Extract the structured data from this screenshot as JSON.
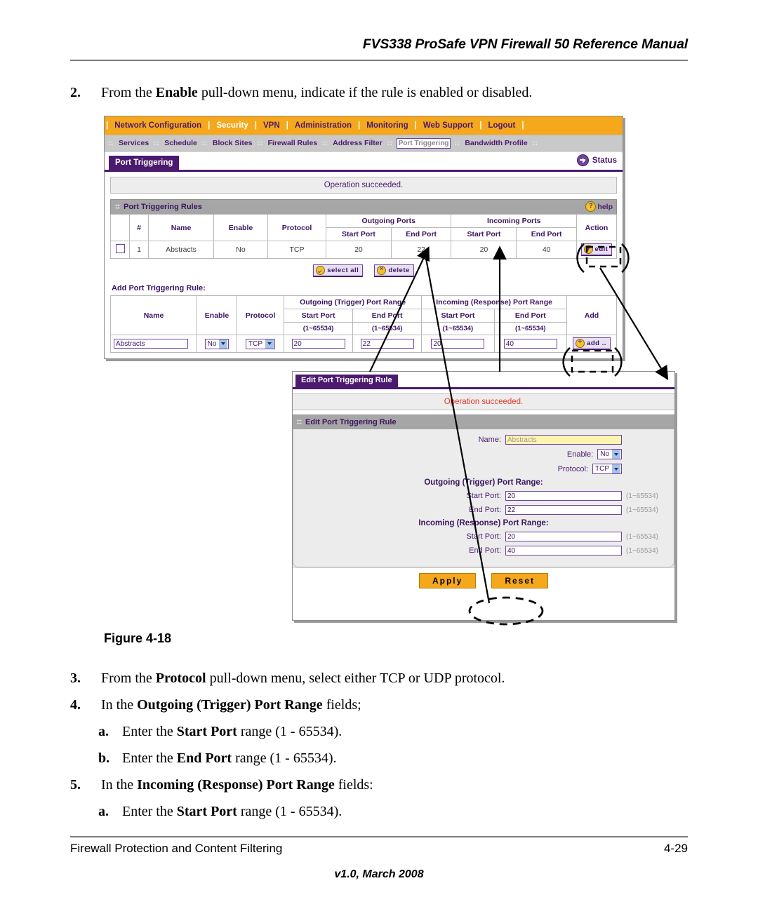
{
  "page": {
    "header_title": "FVS338 ProSafe VPN Firewall 50 Reference Manual",
    "figure_caption": "Figure 4-18",
    "footer_left": "Firewall Protection and Content Filtering",
    "footer_page": "4-29",
    "footer_version": "v1.0, March 2008"
  },
  "steps": [
    {
      "num": "2.",
      "parts": [
        {
          "t": "From the ",
          "b": false
        },
        {
          "t": "Enable",
          "b": true
        },
        {
          "t": " pull-down menu, indicate if the rule is enabled or disabled.",
          "b": false
        }
      ]
    },
    {
      "num": "3.",
      "parts": [
        {
          "t": "From the ",
          "b": false
        },
        {
          "t": "Protocol",
          "b": true
        },
        {
          "t": " pull-down menu, select either TCP or UDP protocol.",
          "b": false
        }
      ]
    },
    {
      "num": "4.",
      "parts": [
        {
          "t": "In the ",
          "b": false
        },
        {
          "t": "Outgoing (Trigger) Port Range",
          "b": true
        },
        {
          "t": " fields;",
          "b": false
        }
      ]
    },
    {
      "num": "a.",
      "parts": [
        {
          "t": "Enter the ",
          "b": false
        },
        {
          "t": "Start Port",
          "b": true
        },
        {
          "t": " range (1 - 65534).",
          "b": false
        }
      ]
    },
    {
      "num": "b.",
      "parts": [
        {
          "t": "Enter the ",
          "b": false
        },
        {
          "t": "End Port",
          "b": true
        },
        {
          "t": " range (1 - 65534).",
          "b": false
        }
      ]
    },
    {
      "num": "5.",
      "parts": [
        {
          "t": "In the ",
          "b": false
        },
        {
          "t": "Incoming (Response) Port Range",
          "b": true
        },
        {
          "t": " fields:",
          "b": false
        }
      ]
    },
    {
      "num": "a.",
      "parts": [
        {
          "t": "Enter the ",
          "b": false
        },
        {
          "t": "Start Port",
          "b": true
        },
        {
          "t": " range (1 - 65534).",
          "b": false
        }
      ]
    }
  ],
  "router": {
    "topnav": [
      "Network Configuration",
      "Security",
      "VPN",
      "Administration",
      "Monitoring",
      "Web Support",
      "Logout"
    ],
    "subnav": [
      "Services",
      "Schedule",
      "Block Sites",
      "Firewall Rules",
      "Address Filter",
      "Port Triggering",
      "Bandwidth Profile"
    ],
    "subnav_selected": "Port Triggering",
    "tab_label": "Port Triggering",
    "status_label": "Status",
    "message": "Operation succeeded.",
    "rules_section_title": "Port Triggering Rules",
    "help_label": "help",
    "rules_table": {
      "group_headers": [
        "#",
        "Name",
        "Enable",
        "Protocol",
        "Outgoing Ports",
        "Incoming Ports",
        "Action"
      ],
      "sub_headers": [
        "Start Port",
        "End Port",
        "Start Port",
        "End Port"
      ],
      "rows": [
        {
          "index": "1",
          "name": "Abstracts",
          "enable": "No",
          "protocol": "TCP",
          "out_start": "20",
          "out_end": "22",
          "in_start": "20",
          "in_end": "40",
          "action": "edit"
        }
      ]
    },
    "buttons": {
      "select_all": "select all",
      "delete": "delete",
      "add": "add .."
    },
    "add_section_label": "Add Port Triggering Rule:",
    "add_table": {
      "group_headers": [
        "Name",
        "Enable",
        "Protocol",
        "Outgoing (Trigger) Port Range",
        "Incoming (Response) Port Range",
        "Add"
      ],
      "sub_headers": [
        "Start Port",
        "End Port",
        "Start Port",
        "End Port"
      ],
      "range_hint": "(1~65534)",
      "values": {
        "name": "Abstracts",
        "enable": "No",
        "protocol": "TCP",
        "out_start": "20",
        "out_end": "22",
        "in_start": "20",
        "in_end": "40"
      }
    }
  },
  "dialog": {
    "tab_label": "Edit Port Triggering Rule",
    "message": "Operation succeeded.",
    "section_title": "Edit Port Triggering Rule",
    "labels": {
      "name": "Name:",
      "enable": "Enable:",
      "protocol": "Protocol:",
      "outgoing_group": "Outgoing (Trigger) Port Range:",
      "incoming_group": "Incoming (Response) Port Range:",
      "start_port": "Start Port:",
      "end_port": "End Port:"
    },
    "range_hint": "(1~65534)",
    "values": {
      "name": "Abstracts",
      "enable": "No",
      "protocol": "TCP",
      "out_start": "20",
      "out_end": "22",
      "in_start": "20",
      "in_end": "40"
    },
    "buttons": {
      "apply": "Apply",
      "reset": "Reset"
    }
  },
  "colors": {
    "nav_orange": "#f5a81c",
    "purple": "#4b1a6f",
    "subnav_gray": "#c9c9c9",
    "section_gray": "#a6a6a6",
    "msg_red": "#e03b2b",
    "highlight_yellow": "#fdf6b0"
  }
}
